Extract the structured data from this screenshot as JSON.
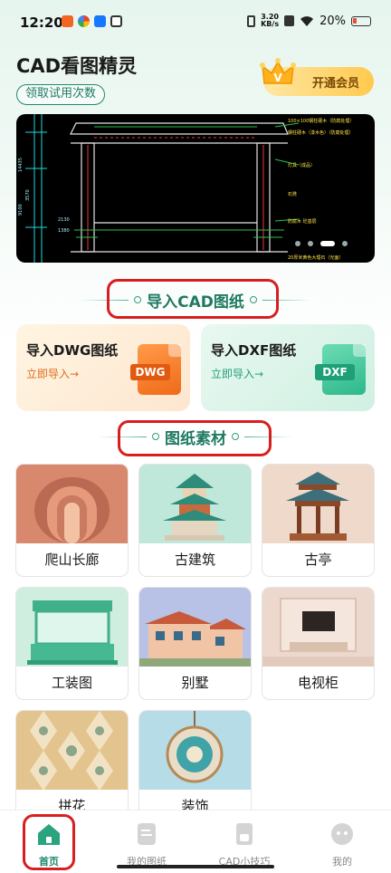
{
  "status_bar": {
    "time": "12:20",
    "net_speed_value": "3.20",
    "net_speed_unit": "KB/s",
    "battery": "20%"
  },
  "header": {
    "app_title": "CAD看图精灵",
    "trial_label": "领取试用次数",
    "vip_label": "开通会员"
  },
  "banner": {
    "annotations": [
      "100×100钢柱硬木（防腐处理）",
      "钢柱硬木（漆木色）（防腐处理）",
      "灯具（成品）",
      "石凳",
      "防腐木 砼基层",
      "20厚米黄色大理石（光面）"
    ],
    "dimension_labels": [
      "14435",
      "9100",
      "3570",
      "2130",
      "1380"
    ],
    "carousel_count": 4,
    "carousel_active_index": 2
  },
  "import_section": {
    "title": "导入CAD图纸",
    "cards": [
      {
        "title": "导入DWG图纸",
        "action": "立即导入→",
        "file_type": "DWG",
        "icon": "dwg-file-icon"
      },
      {
        "title": "导入DXF图纸",
        "action": "立即导入→",
        "file_type": "DXF",
        "icon": "dxf-file-icon"
      }
    ]
  },
  "material_section": {
    "title": "图纸素材",
    "items": [
      {
        "label": "爬山长廊"
      },
      {
        "label": "古建筑"
      },
      {
        "label": "古亭"
      },
      {
        "label": "工装图"
      },
      {
        "label": "别墅"
      },
      {
        "label": "电视柜"
      },
      {
        "label": "拼花"
      },
      {
        "label": "装饰"
      }
    ]
  },
  "bottom_nav": {
    "items": [
      {
        "label": "首页",
        "icon": "home-icon",
        "active": true
      },
      {
        "label": "我的图纸",
        "icon": "document-icon",
        "active": false
      },
      {
        "label": "CAD小技巧",
        "icon": "book-icon",
        "active": false
      },
      {
        "label": "我的",
        "icon": "profile-icon",
        "active": false
      }
    ]
  },
  "colors": {
    "brand_green": "#1f8a6d",
    "dwg_orange": "#f06a18",
    "dxf_green": "#2db88b",
    "highlight_red": "#d81e1e"
  }
}
